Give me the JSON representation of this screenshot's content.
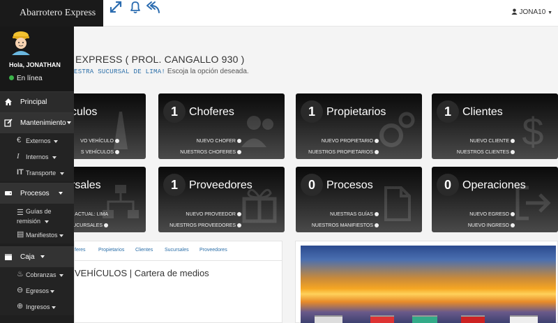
{
  "brand": "Abarrotero Express",
  "user_menu": "JONA10",
  "profile": {
    "greeting": "Hola, JONATHAN",
    "status": "En línea"
  },
  "nav": {
    "principal": "Principal",
    "mantenimiento": "Mantenimiento",
    "externos": "Externos",
    "internos": "Internos",
    "transporte": "Transporte",
    "procesos": "Procesos",
    "guias_line1": "Guías de",
    "guias_line2": "remisión",
    "manifiestos": "Manifiestos",
    "caja": "Caja",
    "cobranzas": "Cobranzas",
    "egresos": "Egresos",
    "ingresos": "Ingresos"
  },
  "heading": "EXPRESS ( PROL. CANGALLO 930 )",
  "subheading": {
    "highlight": "ESTRA SUCURSAL DE LIMA!",
    "rest": "Escoja la opción deseada."
  },
  "tiles": [
    {
      "num": "",
      "title": "culos",
      "link1": "VO VEHÍCULO",
      "link2": "S VEHÍCULOS"
    },
    {
      "num": "1",
      "title": "Choferes",
      "link1": "NUEVO CHOFER",
      "link2": "NUESTROS CHOFERES"
    },
    {
      "num": "1",
      "title": "Propietarios",
      "link1": "NUEVO PROPIETARIO",
      "link2": "NUESTROS PROPIETARIOS"
    },
    {
      "num": "1",
      "title": "Clientes",
      "link1": "NUEVO CLIENTE",
      "link2": "NUESTROS CLIENTES"
    },
    {
      "num": "",
      "title": "rsales",
      "link1": "ASAL ACTUAL: LIMA",
      "link2": "AS SUCURSALES"
    },
    {
      "num": "1",
      "title": "Proveedores",
      "link1": "NUEVO PROVEEDOR",
      "link2": "NUESTROS PROVEEDORES"
    },
    {
      "num": "0",
      "title": "Procesos",
      "link1": "NUESTRAS GUÍAS",
      "link2": "NUESTROS MANIFIESTOS"
    },
    {
      "num": "0",
      "title": "Operaciones",
      "link1": "NUEVO EGRESO",
      "link2": "NUEVO INGRESO"
    }
  ],
  "tabs": [
    "feres",
    "Propietarios",
    "Clientes",
    "Sucursales",
    "Proveedores"
  ],
  "panel_title": "VEHÍCULOS | Cartera de medios",
  "colors": {
    "sidebar": "#1f1f1f",
    "tile_top": "#0a0a0a",
    "tile_bottom": "#4a4a4a",
    "link": "#2a6ea8",
    "online": "#3bb34a",
    "top_icons": "#2b6cb0"
  }
}
